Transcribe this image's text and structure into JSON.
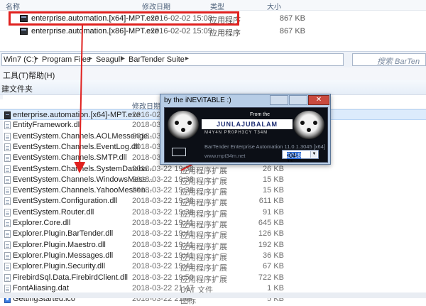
{
  "top": {
    "columns": [
      "名称",
      "修改日期",
      "类型",
      "大小"
    ],
    "rows": [
      {
        "name": "enterprise.automation.[x64]-MPT.exe",
        "date": "2016-02-02 15:08",
        "type": "应用程序",
        "size": "867 KB"
      },
      {
        "name": "enterprise.automation.[x86]-MPT.exe",
        "date": "2016-02-02 15:09",
        "type": "应用程序",
        "size": "867 KB"
      }
    ]
  },
  "address": {
    "crumbs": [
      "Win7 (C:)",
      "Program Files",
      "Seagull",
      "BarTender Suite"
    ],
    "search_placeholder": "搜索 BarTen"
  },
  "menu": {
    "items": [
      "工具(T)",
      "帮助(H)"
    ]
  },
  "toolbar": {
    "item": "建文件夹"
  },
  "list": {
    "columns": [
      "修改日期"
    ],
    "rows": [
      {
        "name": "enterprise.automation.[x64]-MPT.exe",
        "date": "2016-02-",
        "type": "",
        "size": "",
        "icon": "exe"
      },
      {
        "name": "EntityFramework.dll",
        "date": "2018-03-",
        "type": "",
        "size": "",
        "icon": "dll"
      },
      {
        "name": "EventSystem.Channels.AOLMessenge...",
        "date": "2018-03-",
        "type": "",
        "size": "",
        "icon": "dll"
      },
      {
        "name": "EventSystem.Channels.EventLog.dll",
        "date": "2018-03-",
        "type": "",
        "size": "",
        "icon": "dll"
      },
      {
        "name": "EventSystem.Channels.SMTP.dll",
        "date": "2018-03-",
        "type": "",
        "size": "",
        "icon": "dll"
      },
      {
        "name": "EventSystem.Channels.SystemDataba...",
        "date": "2018-03-22 19:38",
        "type": "应用程序扩展",
        "size": "26 KB",
        "icon": "dll"
      },
      {
        "name": "EventSystem.Channels.WindowsMess...",
        "date": "2018-03-22 19:38",
        "type": "应用程序扩展",
        "size": "15 KB",
        "icon": "dll"
      },
      {
        "name": "EventSystem.Channels.YahooMessen...",
        "date": "2018-03-22 19:38",
        "type": "应用程序扩展",
        "size": "15 KB",
        "icon": "dll"
      },
      {
        "name": "EventSystem.Configuration.dll",
        "date": "2018-03-22 19:38",
        "type": "应用程序扩展",
        "size": "611 KB",
        "icon": "dll"
      },
      {
        "name": "EventSystem.Router.dll",
        "date": "2018-03-22 19:38",
        "type": "应用程序扩展",
        "size": "91 KB",
        "icon": "dll"
      },
      {
        "name": "Explorer.Core.dll",
        "date": "2018-03-22 19:41",
        "type": "应用程序扩展",
        "size": "645 KB",
        "icon": "dll"
      },
      {
        "name": "Explorer.Plugin.BarTender.dll",
        "date": "2018-03-22 19:41",
        "type": "应用程序扩展",
        "size": "126 KB",
        "icon": "dll"
      },
      {
        "name": "Explorer.Plugin.Maestro.dll",
        "date": "2018-03-22 19:41",
        "type": "应用程序扩展",
        "size": "192 KB",
        "icon": "dll"
      },
      {
        "name": "Explorer.Plugin.Messages.dll",
        "date": "2018-03-22 19:41",
        "type": "应用程序扩展",
        "size": "36 KB",
        "icon": "dll"
      },
      {
        "name": "Explorer.Plugin.Security.dll",
        "date": "2018-03-22 19:41",
        "type": "应用程序扩展",
        "size": "67 KB",
        "icon": "dll"
      },
      {
        "name": "FirebirdSql.Data.FirebirdClient.dll",
        "date": "2018-03-22 19:50",
        "type": "应用程序扩展",
        "size": "722 KB",
        "icon": "dll"
      },
      {
        "name": "FontAliasing.dat",
        "date": "2018-03-22 21:47",
        "type": "DAT 文件",
        "size": "1 KB",
        "icon": "dat"
      },
      {
        "name": "GettingStarted.ico",
        "date": "2018-03-22 21:47",
        "type": "图标",
        "size": "5 KB",
        "icon": "ico"
      }
    ]
  },
  "dialog": {
    "title": "by the iNEViTABLE :)",
    "brand_top": "From the",
    "brand": "JUNLAJUBALAM",
    "tagline": "M4Y4N PR0PH3CY T34M",
    "product": "BarTender Enterprise Automation 11.0.1.3045 [x64]",
    "url": "www.mpt34m.net",
    "date_year": "2018",
    "date_rest": "-04-11"
  },
  "colors": {
    "highlight_red": "#e0211f",
    "arrow_red": "#e0211f"
  }
}
